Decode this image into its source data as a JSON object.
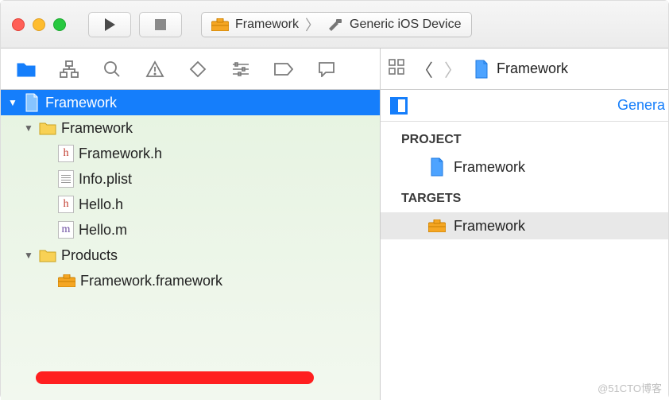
{
  "toolbar": {
    "scheme_target": "Framework",
    "scheme_device": "Generic iOS Device"
  },
  "breadcrumb": {
    "item": "Framework"
  },
  "navigator": {
    "root": "Framework",
    "groups": [
      {
        "name": "Framework",
        "files": [
          "Framework.h",
          "Info.plist",
          "Hello.h",
          "Hello.m"
        ]
      },
      {
        "name": "Products",
        "files": [
          "Framework.framework"
        ]
      }
    ]
  },
  "editor": {
    "active_tab": "Genera",
    "project_header": "PROJECT",
    "project_name": "Framework",
    "targets_header": "TARGETS",
    "target_name": "Framework"
  },
  "watermark": "@51CTO博客"
}
